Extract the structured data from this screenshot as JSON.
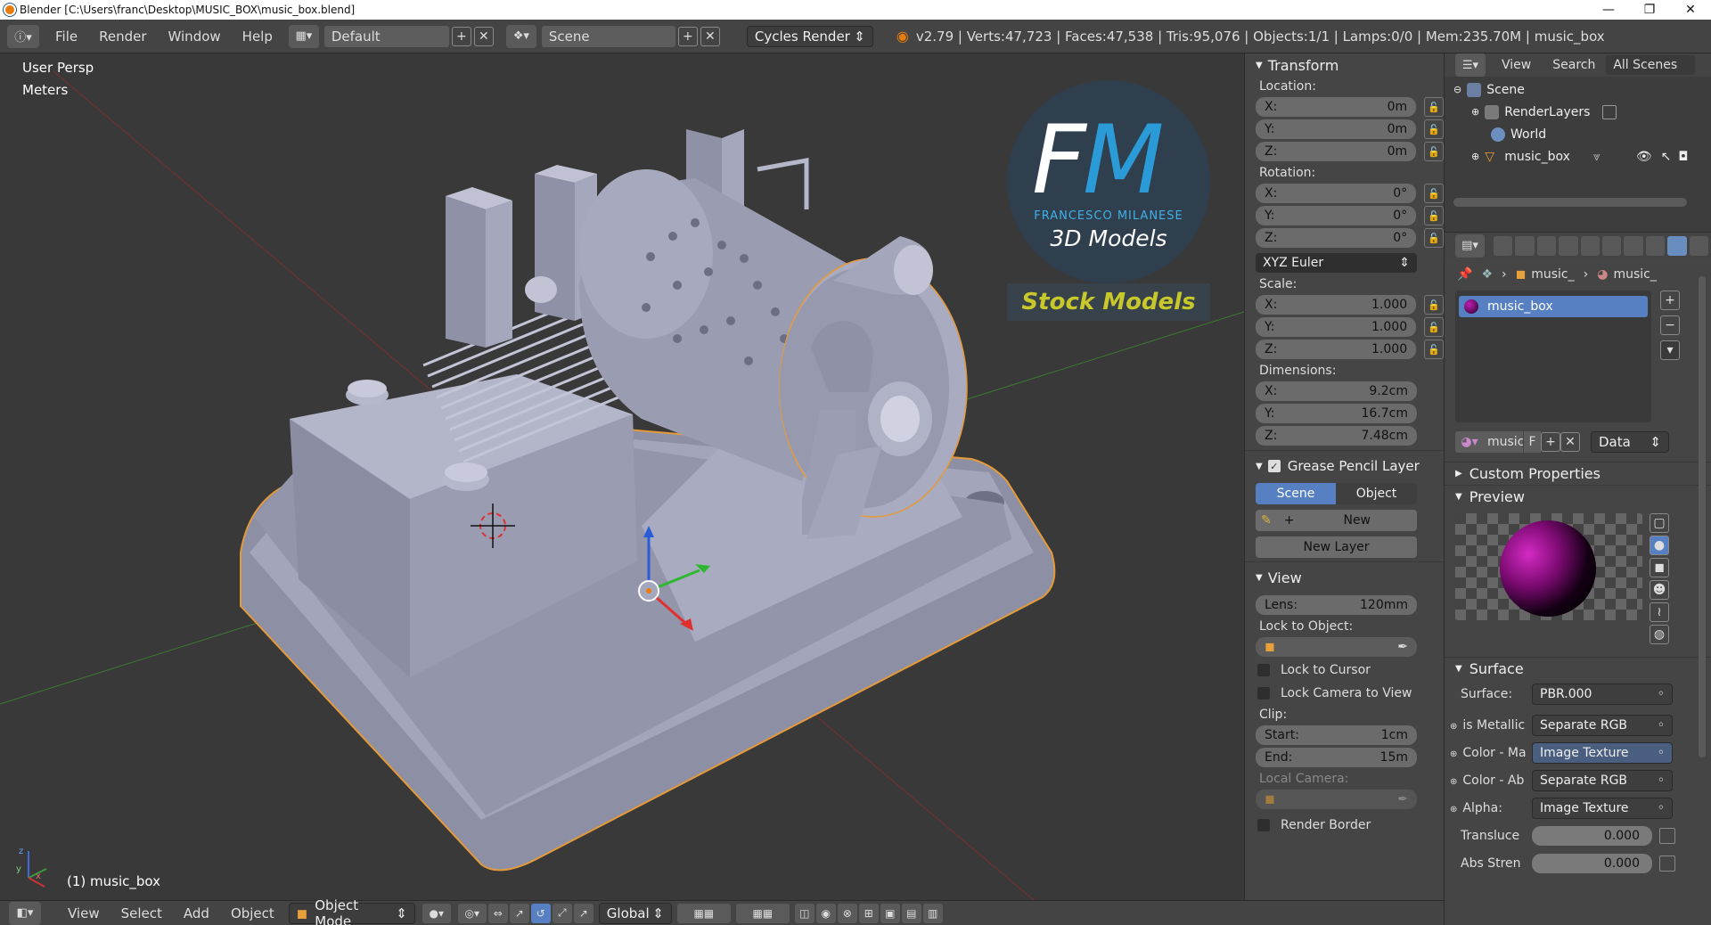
{
  "window": {
    "title": "Blender [C:\\Users\\franc\\Desktop\\MUSIC_BOX\\music_box.blend]",
    "minimize": "—",
    "maximize": "❐",
    "close": "✕"
  },
  "infobar": {
    "menus": [
      "File",
      "Render",
      "Window",
      "Help"
    ],
    "layout": "Default",
    "scene": "Scene",
    "engine": "Cycles Render",
    "stats": "v2.79 | Verts:47,723 | Faces:47,538 | Tris:95,076 | Objects:1/1 | Lamps:0/0 | Mem:235.70M | music_box"
  },
  "viewport": {
    "view_name": "User Persp",
    "units": "Meters",
    "object_label": "(1) music_box",
    "watermark": {
      "logo_letters": "FM",
      "author": "FRANCESCO MILANESE",
      "tagline": "3D Models",
      "badge": "Stock Models"
    }
  },
  "viewport_header": {
    "menus": [
      "View",
      "Select",
      "Add",
      "Object"
    ],
    "mode": "Object Mode",
    "orientation": "Global"
  },
  "npanel": {
    "transform": {
      "title": "Transform",
      "location_label": "Location:",
      "location": [
        {
          "axis": "X:",
          "value": "0m"
        },
        {
          "axis": "Y:",
          "value": "0m"
        },
        {
          "axis": "Z:",
          "value": "0m"
        }
      ],
      "rotation_label": "Rotation:",
      "rotation": [
        {
          "axis": "X:",
          "value": "0°"
        },
        {
          "axis": "Y:",
          "value": "0°"
        },
        {
          "axis": "Z:",
          "value": "0°"
        }
      ],
      "rotation_mode": "XYZ Euler",
      "scale_label": "Scale:",
      "scale": [
        {
          "axis": "X:",
          "value": "1.000"
        },
        {
          "axis": "Y:",
          "value": "1.000"
        },
        {
          "axis": "Z:",
          "value": "1.000"
        }
      ],
      "dimensions_label": "Dimensions:",
      "dimensions": [
        {
          "axis": "X:",
          "value": "9.2cm"
        },
        {
          "axis": "Y:",
          "value": "16.7cm"
        },
        {
          "axis": "Z:",
          "value": "7.48cm"
        }
      ]
    },
    "grease_pencil": {
      "title": "Grease Pencil Layer",
      "tab_scene": "Scene",
      "tab_object": "Object",
      "new_label": "New",
      "new_layer_label": "New Layer"
    },
    "view": {
      "title": "View",
      "lens_label": "Lens:",
      "lens_value": "120mm",
      "lock_object_label": "Lock to Object:",
      "lock_cursor": "Lock to Cursor",
      "lock_camera": "Lock Camera to View",
      "clip_label": "Clip:",
      "clip_start_label": "Start:",
      "clip_start": "1cm",
      "clip_end_label": "End:",
      "clip_end": "15m",
      "local_camera": "Local Camera:",
      "render_border": "Render Border"
    }
  },
  "outliner": {
    "header": {
      "view": "View",
      "search": "Search",
      "filter": "All Scenes"
    },
    "items": [
      {
        "label": "Scene",
        "depth": 0
      },
      {
        "label": "RenderLayers",
        "depth": 1
      },
      {
        "label": "World",
        "depth": 1
      },
      {
        "label": "music_box",
        "depth": 1
      }
    ]
  },
  "properties": {
    "breadcrumb": [
      "music_",
      "music_"
    ],
    "material_slot": "music_box",
    "datablock_name": "music",
    "datablock_fake": "F",
    "link_mode": "Data",
    "custom_properties": "Custom Properties",
    "preview": "Preview",
    "surface_title": "Surface",
    "surface_label": "Surface:",
    "surface_value": "PBR.000",
    "inputs": [
      {
        "label": "is Metallic",
        "value": "Separate RGB",
        "highlight": false
      },
      {
        "label": "Color - Ma",
        "value": "Image Texture",
        "highlight": true
      },
      {
        "label": "Color - Ab",
        "value": "Separate RGB",
        "highlight": false
      },
      {
        "label": "Alpha:",
        "value": "Image Texture",
        "highlight": false
      }
    ],
    "sliders": [
      {
        "label": "Transluce",
        "value": "0.000"
      },
      {
        "label": "Abs Stren",
        "value": "0.000"
      }
    ]
  },
  "colors": {
    "model": "#9c9eb3",
    "background": "#393939",
    "panel": "#454545",
    "accent_blue": "#5680c2",
    "badge_text": "#c8c82a"
  }
}
